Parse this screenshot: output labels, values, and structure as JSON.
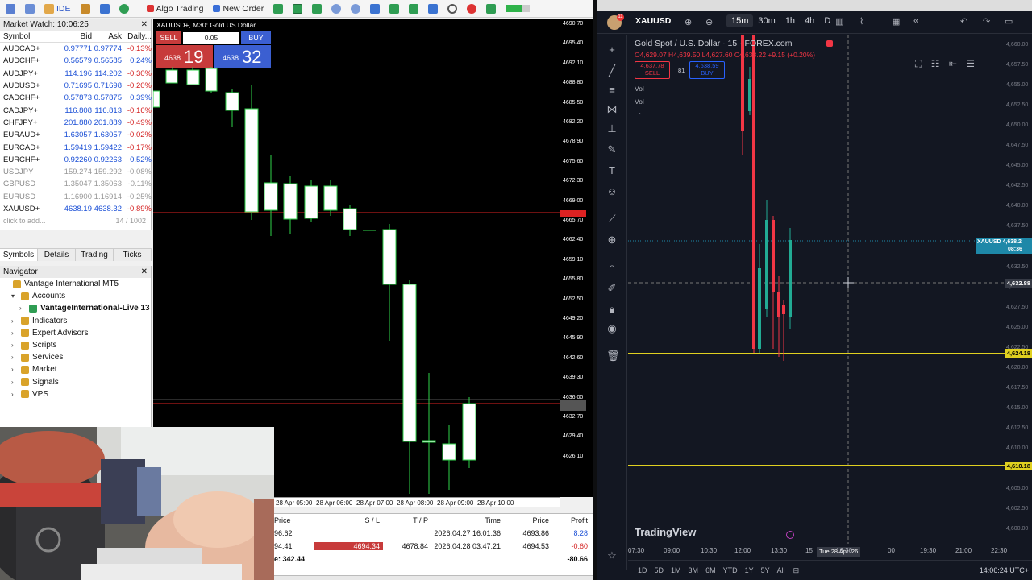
{
  "mt5": {
    "toolbar": {
      "algo_trading": "Algo Trading",
      "new_order": "New Order",
      "ide": "IDE"
    },
    "market_watch": {
      "title": "Market Watch: 10:06:25",
      "headers": [
        "Symbol",
        "Bid",
        "Ask",
        "Daily..."
      ],
      "rows": [
        {
          "symbol": "AUDCAD+",
          "bid": "0.97771",
          "ask": "0.97774",
          "daily": "-0.13%"
        },
        {
          "symbol": "AUDCHF+",
          "bid": "0.56579",
          "ask": "0.56585",
          "daily": "0.24%"
        },
        {
          "symbol": "AUDJPY+",
          "bid": "114.196",
          "ask": "114.202",
          "daily": "-0.30%"
        },
        {
          "symbol": "AUDUSD+",
          "bid": "0.71695",
          "ask": "0.71698",
          "daily": "-0.20%"
        },
        {
          "symbol": "CADCHF+",
          "bid": "0.57873",
          "ask": "0.57875",
          "daily": "0.39%"
        },
        {
          "symbol": "CADJPY+",
          "bid": "116.808",
          "ask": "116.813",
          "daily": "-0.16%"
        },
        {
          "symbol": "CHFJPY+",
          "bid": "201.880",
          "ask": "201.889",
          "daily": "-0.49%"
        },
        {
          "symbol": "EURAUD+",
          "bid": "1.63057",
          "ask": "1.63057",
          "daily": "-0.02%"
        },
        {
          "symbol": "EURCAD+",
          "bid": "1.59419",
          "ask": "1.59422",
          "daily": "-0.17%"
        },
        {
          "symbol": "EURCHF+",
          "bid": "0.92260",
          "ask": "0.92263",
          "daily": "0.52%"
        },
        {
          "symbol": "USDJPY",
          "bid": "159.274",
          "ask": "159.292",
          "daily": "-0.08%"
        },
        {
          "symbol": "GBPUSD",
          "bid": "1.35047",
          "ask": "1.35063",
          "daily": "-0.11%"
        },
        {
          "symbol": "EURUSD",
          "bid": "1.16900",
          "ask": "1.16914",
          "daily": "-0.25%"
        },
        {
          "symbol": "XAUUSD+",
          "bid": "4638.19",
          "ask": "4638.32",
          "daily": "-0.89%"
        }
      ],
      "add_text": "click to add...",
      "count": "14 / 1002",
      "tabs": [
        "Symbols",
        "Details",
        "Trading",
        "Ticks"
      ]
    },
    "navigator": {
      "title": "Navigator",
      "items": [
        {
          "label": "Vantage International MT5",
          "indent": 0,
          "tri": ""
        },
        {
          "label": "Accounts",
          "indent": 1,
          "tri": "▾"
        },
        {
          "label": "VantageInternational-Live 13",
          "indent": 2,
          "tri": "›"
        },
        {
          "label": "Indicators",
          "indent": 1,
          "tri": "›"
        },
        {
          "label": "Expert Advisors",
          "indent": 1,
          "tri": "›"
        },
        {
          "label": "Scripts",
          "indent": 1,
          "tri": "›"
        },
        {
          "label": "Services",
          "indent": 1,
          "tri": "›"
        },
        {
          "label": "Market",
          "indent": 1,
          "tri": "›"
        },
        {
          "label": "Signals",
          "indent": 1,
          "tri": "›"
        },
        {
          "label": "VPS",
          "indent": 1,
          "tri": "›"
        }
      ]
    },
    "chart": {
      "title": "XAUUSD+, M30: Gold US Dollar",
      "sell_label": "SELL",
      "buy_label": "BUY",
      "lot": "0.05",
      "sell_price_small": "4638",
      "sell_price_big": "19",
      "buy_price_small": "4638",
      "buy_price_big": "32",
      "price_ticks": [
        "4690.70",
        "4695.40",
        "4692.10",
        "4688.80",
        "4685.50",
        "4682.20",
        "4678.90",
        "4675.60",
        "4672.30",
        "4669.00",
        "4665.70",
        "4662.40",
        "4659.10",
        "4655.80",
        "4652.50",
        "4649.20",
        "4645.90",
        "4642.60",
        "4639.30",
        "4636.00",
        "4632.70",
        "4629.40",
        "4626.10"
      ],
      "time_ticks": [
        "28 Apr 05:00",
        "28 Apr 06:00",
        "28 Apr 07:00",
        "28 Apr 08:00",
        "28 Apr 09:00",
        "28 Apr 10:00"
      ]
    },
    "trades": {
      "headers": [
        "Price",
        "S / L",
        "T / P",
        "Time",
        "Price",
        "Profit"
      ],
      "rows": [
        {
          "price": "96.62",
          "sl": "",
          "tp": "",
          "time": "2026.04.27 16:01:36",
          "cur": "4693.86",
          "profit": "8.28"
        },
        {
          "price": "94.41",
          "sl": "4694.34",
          "tp": "4678.84",
          "time": "2026.04.28 03:47:21",
          "cur": "4694.53",
          "profit": "-0.60"
        }
      ],
      "balance_line": "e: 342.44",
      "total": "-80.66"
    }
  },
  "tv": {
    "symbol": "XAUUSD",
    "timeframes": [
      "15m",
      "30m",
      "1h",
      "4h",
      "D"
    ],
    "title": "Gold Spot / U.S. Dollar · 15 · FOREX.com",
    "ohlc": "O4,629.07 H4,639.50 L4,627.60 C4,638.22 +9.15 (+0.20%)",
    "sell_price": "4,637.78",
    "sell_label": "SELL",
    "spread": "81",
    "buy_price": "4,638.59",
    "buy_label": "BUY",
    "vol1": "Vol",
    "vol2": "Vol",
    "price_ticks": [
      "4,660.00",
      "4,657.50",
      "4,655.00",
      "4,652.50",
      "4,650.00",
      "4,647.50",
      "4,645.00",
      "4,642.50",
      "4,640.00",
      "4,637.50",
      "4,635.00",
      "4,632.50",
      "4,630.00",
      "4,627.50",
      "4,625.00",
      "4,622.50",
      "4,620.00",
      "4,617.50",
      "4,615.00",
      "4,612.50",
      "4,610.00",
      "4,607.50",
      "4,605.00",
      "4,602.50",
      "4,600.00"
    ],
    "current_tag": "XAUUSD",
    "current_price": "4,638.2",
    "current_countdown": "08:36",
    "cross_price": "4,632.88",
    "hline1": "4,624.18",
    "hline2": "4,610.18",
    "time_ticks": [
      "07:30",
      "09:00",
      "10:30",
      "12:00",
      "13:30",
      "15",
      "16:30",
      "00",
      "19:30",
      "21:00",
      "22:30"
    ],
    "cross_time": "Tue 28 Apr '26",
    "ranges": [
      "1D",
      "5D",
      "1M",
      "3M",
      "6M",
      "YTD",
      "1Y",
      "5Y",
      "All"
    ],
    "clock": "14:06:24 UTC+",
    "logo": "TradingView"
  }
}
